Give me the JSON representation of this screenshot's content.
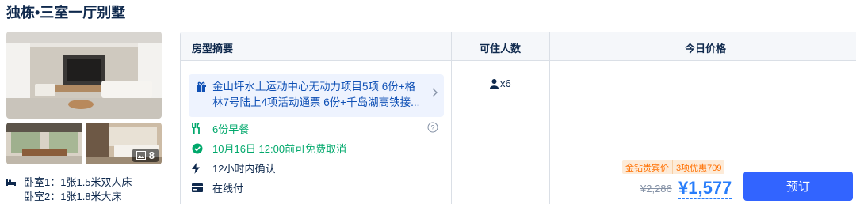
{
  "room": {
    "title": "独栋•三室一厅别墅",
    "photo_count": "8",
    "beds": [
      {
        "label": "卧室1：",
        "value": "1张1.5米双人床"
      },
      {
        "label": "卧室2：",
        "value": "1张1.8米大床"
      }
    ]
  },
  "table": {
    "headers": {
      "summary": "房型摘要",
      "occupancy": "可住人数",
      "price": "今日价格"
    },
    "package_text": "金山坪水上运动中心无动力项目5项 6份+格林7号陆上4项活动通票 6份+千岛湖高铁接...",
    "features": {
      "breakfast": "6份早餐",
      "cancel": "10月16日 12:00前可免费取消",
      "confirm": "12小时内确认",
      "payment": "在线付"
    },
    "occupancy": "x6",
    "promo": {
      "tag": "金钻贵宾价",
      "discount": "3项优惠709"
    },
    "price_original": "¥2,286",
    "price_current": "¥1,577",
    "book_label": "预订"
  },
  "colors": {
    "accent": "#287dfa",
    "button": "#3264ff",
    "green": "#00a86b",
    "promo": "#ff6f00"
  }
}
